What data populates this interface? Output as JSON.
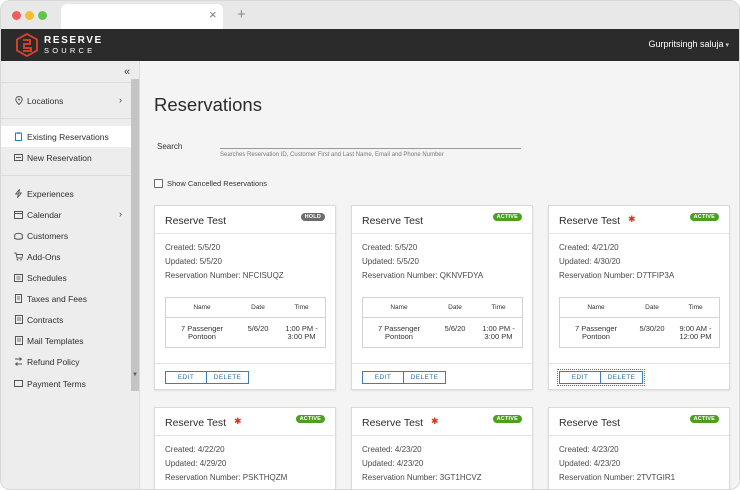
{
  "browser": {
    "tab_close": "×",
    "new_tab": "+"
  },
  "header": {
    "logo_line1": "RESERVE",
    "logo_line2": "SOURCE",
    "user_name": "Gurpritsingh saluja",
    "user_caret": "▾"
  },
  "sidebar": {
    "collapse": "«",
    "items": [
      {
        "label": "Locations",
        "icon": "map-pin-icon",
        "chevron": "›"
      },
      {
        "label": "Existing Reservations",
        "icon": "clipboard-icon"
      },
      {
        "label": "New Reservation",
        "icon": "list-icon"
      },
      {
        "label": "Experiences",
        "icon": "bolt-icon"
      },
      {
        "label": "Calendar",
        "icon": "calendar-icon",
        "chevron": "›"
      },
      {
        "label": "Customers",
        "icon": "users-icon"
      },
      {
        "label": "Add-Ons",
        "icon": "cart-icon"
      },
      {
        "label": "Schedules",
        "icon": "schedule-icon"
      },
      {
        "label": "Taxes and Fees",
        "icon": "receipt-icon"
      },
      {
        "label": "Contracts",
        "icon": "document-icon"
      },
      {
        "label": "Mail Templates",
        "icon": "mail-icon"
      },
      {
        "label": "Refund Policy",
        "icon": "refund-icon"
      },
      {
        "label": "Payment Terms",
        "icon": "card-icon"
      }
    ],
    "active_index": 1
  },
  "main": {
    "title": "Reservations",
    "search": {
      "label": "Search",
      "value": "",
      "hint": "Searches Reservation ID, Customer First and Last Name, Email and Phone Number"
    },
    "show_cancelled": {
      "label": "Show Cancelled Reservations",
      "checked": false
    },
    "table_headers": [
      "Name",
      "Date",
      "Time"
    ],
    "edit_label": "EDIT",
    "delete_label": "DELETE",
    "cards": [
      {
        "name": "Reserve Test",
        "flag": false,
        "status": "HOLD",
        "created": "Created: 5/5/20",
        "updated": "Updated: 5/5/20",
        "number": "Reservation Number: NFCISUQZ",
        "item": {
          "name": "7 Passenger Pontoon",
          "date": "5/6/20",
          "time": "1:00 PM - 3:00 PM"
        }
      },
      {
        "name": "Reserve Test",
        "flag": false,
        "status": "ACTIVE",
        "created": "Created: 5/5/20",
        "updated": "Updated: 5/5/20",
        "number": "Reservation Number: QKNVFDYA",
        "item": {
          "name": "7 Passenger Pontoon",
          "date": "5/6/20",
          "time": "1:00 PM - 3:00 PM"
        }
      },
      {
        "name": "Reserve Test",
        "flag": true,
        "status": "ACTIVE",
        "created": "Created: 4/21/20",
        "updated": "Updated: 4/30/20",
        "number": "Reservation Number: D7TFIP3A",
        "item": {
          "name": "7 Passenger Pontoon",
          "date": "5/30/20",
          "time": "9:00 AM - 12:00 PM"
        }
      },
      {
        "name": "Reserve Test",
        "flag": true,
        "status": "ACTIVE",
        "created": "Created: 4/22/20",
        "updated": "Updated: 4/29/20",
        "number": "Reservation Number: PSKTHQZM"
      },
      {
        "name": "Reserve Test",
        "flag": true,
        "status": "ACTIVE",
        "created": "Created: 4/23/20",
        "updated": "Updated: 4/23/20",
        "number": "Reservation Number: 3GT1HCVZ"
      },
      {
        "name": "Reserve Test",
        "flag": false,
        "status": "ACTIVE",
        "created": "Created: 4/23/20",
        "updated": "Updated: 4/23/20",
        "number": "Reservation Number: 2TVTGIR1"
      }
    ]
  },
  "colors": {
    "header_bg": "#2b2b2b",
    "brand_orange": "#e0432a",
    "active_badge": "#4ca01f",
    "hold_badge": "#6c6c6c",
    "link_blue": "#2f6fa8",
    "flag_red": "#e0301e"
  }
}
